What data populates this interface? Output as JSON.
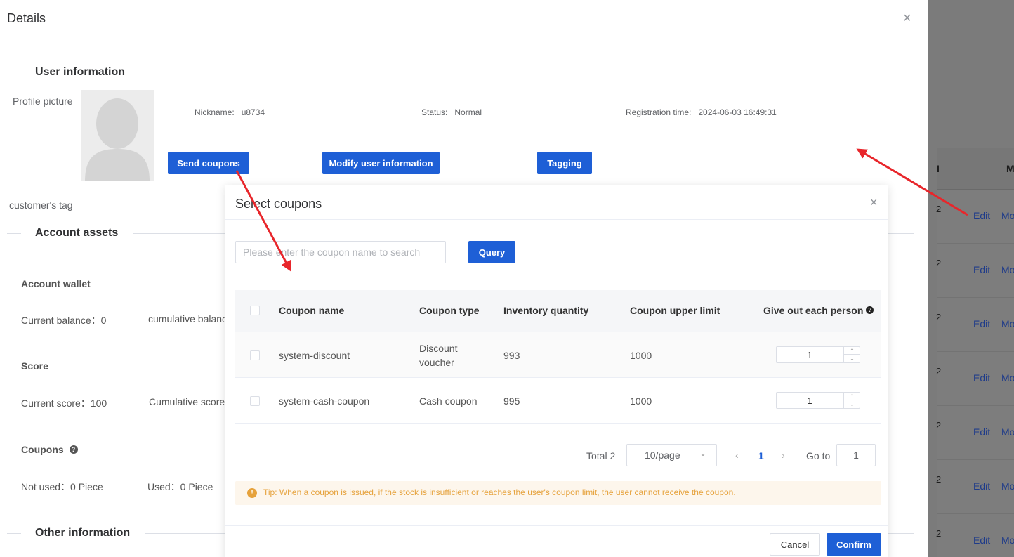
{
  "drawer": {
    "title": "Details",
    "close": "×"
  },
  "user_info": {
    "section_title": "User information",
    "profile_label": "Profile picture",
    "nickname_label": "Nickname:",
    "nickname": "u8734",
    "status_label": "Status:",
    "status": "Normal",
    "reg_label": "Registration time:",
    "reg_time": "2024-06-03 16:49:31",
    "send_coupons": "Send coupons",
    "modify_info": "Modify user information",
    "tagging": "Tagging",
    "customer_tag": "customer's tag"
  },
  "assets": {
    "section_title": "Account assets",
    "wallet_title": "Account wallet",
    "current_balance": "Current balance：0",
    "cumulative_balance": "cumulative balanc",
    "score_title": "Score",
    "current_score": "Current score：100",
    "cumulative_score": "Cumulative score",
    "coupons_title": "Coupons",
    "not_used": "Not used：0  Piece",
    "used": "Used：0  Piece"
  },
  "other": {
    "section_title": "Other information"
  },
  "dialog": {
    "title": "Select coupons",
    "close": "×",
    "search_placeholder": "Please enter the coupon name to search",
    "query": "Query",
    "columns": {
      "name": "Coupon name",
      "type": "Coupon type",
      "inventory": "Inventory quantity",
      "upper": "Coupon upper limit",
      "each": "Give out each person"
    },
    "rows": [
      {
        "name": "system-discount",
        "type_line1": "Discount",
        "type_line2": "voucher",
        "inventory": "993",
        "upper": "1000",
        "each": "1"
      },
      {
        "name": "system-cash-coupon",
        "type_line1": "Cash coupon",
        "type_line2": "",
        "inventory": "995",
        "upper": "1000",
        "each": "1"
      }
    ],
    "pager": {
      "total": "Total 2",
      "page_size": "10/page",
      "current_page": "1",
      "goto_label": "Go to",
      "goto_value": "1"
    },
    "tip": "Tip: When a coupon is issued, if the stock is insufficient or reaches the user's coupon limit, the user cannot receive the coupon.",
    "cancel": "Cancel",
    "confirm": "Confirm"
  },
  "background_table": {
    "header_cols": [
      "I",
      "M"
    ],
    "rows": [
      {
        "a": "2",
        "edit": "Edit",
        "more": "Mo"
      },
      {
        "a": "2",
        "edit": "Edit",
        "more": "Mo"
      },
      {
        "a": "2",
        "edit": "Edit",
        "more": "Mo"
      },
      {
        "a": "2",
        "edit": "Edit",
        "more": "Mo"
      },
      {
        "a": "2",
        "edit": "Edit",
        "more": "Mo"
      },
      {
        "a": "2",
        "edit": "Edit",
        "more": "Mo"
      },
      {
        "a": "2",
        "edit": "Edit",
        "more": "Mo"
      }
    ]
  },
  "colors": {
    "primary": "#1e5fd6",
    "annotation_arrow": "#e8262b",
    "tip_text": "#e6a23c",
    "overlay": "#7b7b7b"
  }
}
